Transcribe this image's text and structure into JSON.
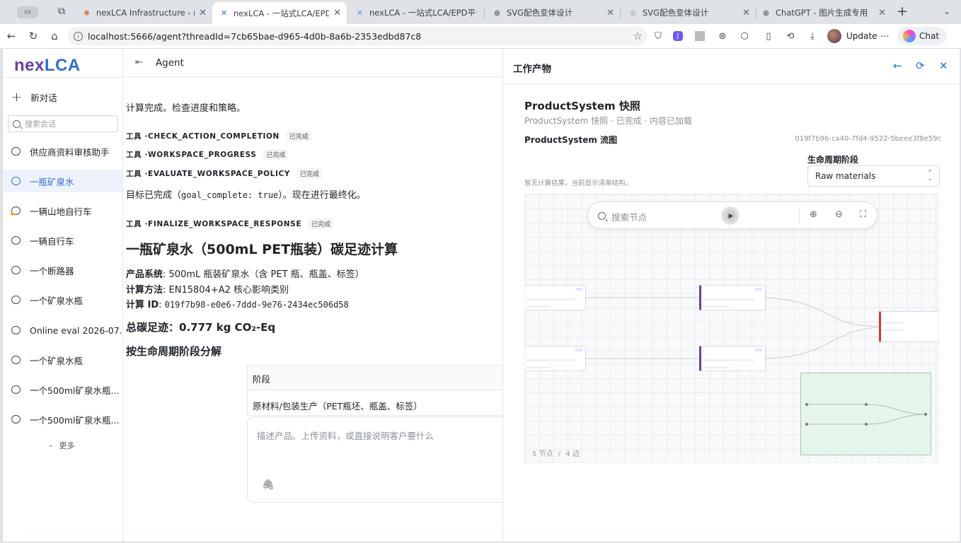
{
  "browser": {
    "tabs": [
      {
        "title": "nexLCA Infrastructure - nexLC",
        "icon": "claude-icon",
        "active": false
      },
      {
        "title": "nexLCA - 一站式LCA/EPD平台",
        "icon": "x-icon",
        "active": true
      },
      {
        "title": "nexLCA - 一站式LCA/EPD平台",
        "icon": "x-icon",
        "active": false
      },
      {
        "title": "SVG配色变体设计",
        "icon": "openai-icon",
        "active": false
      },
      {
        "title": "SVG配色变体设计",
        "icon": "openai-icon",
        "active": false
      },
      {
        "title": "ChatGPT - 图片生成专用",
        "icon": "openai-icon",
        "active": false
      }
    ],
    "url": "localhost:5666/agent?threadId=7cb65bae-d965-4d0b-8a6b-2353edbd87c8",
    "update_label": "Update",
    "chat_label": "Chat"
  },
  "sidebar": {
    "brand_n": "n",
    "brand_rest": "ex",
    "brand_lca": "LCA",
    "new_chat": "新对话",
    "search_placeholder": "搜索会话",
    "conversations": [
      {
        "label": "供应商资料审核助手"
      },
      {
        "label": "一瓶矿泉水"
      },
      {
        "label": "一辆山地自行车"
      },
      {
        "label": "一辆自行车"
      },
      {
        "label": "一个断路器"
      },
      {
        "label": "一个矿泉水瓶"
      },
      {
        "label": "Online eval 2026-07..."
      },
      {
        "label": "一个矿泉水瓶"
      },
      {
        "label": "一个500ml矿泉水瓶..."
      },
      {
        "label": "一个500ml矿泉水瓶..."
      }
    ],
    "more": "更多"
  },
  "main": {
    "title": "Agent",
    "msg_calc_done": "计算完成。检查进度和策略。",
    "tool_prefix": "工具 · ",
    "tools": [
      {
        "name": "CHECK_ACTION_COMPLETION",
        "status": "已完成"
      },
      {
        "name": "WORKSPACE_PROGRESS",
        "status": "已完成"
      },
      {
        "name": "EVALUATE_WORKSPACE_POLICY",
        "status": "已完成"
      }
    ],
    "goal_pre": "目标已完成（",
    "goal_code": "goal_complete: true",
    "goal_post": "）。现在进行最终化。",
    "finalize_tool": {
      "name": "FINALIZE_WORKSPACE_RESPONSE",
      "status": "已完成"
    },
    "report_title": "一瓶矿泉水（500mL PET瓶装）碳足迹计算",
    "product_label": "产品系统",
    "product_value": ": 500mL 瓶装矿泉水（含 PET 瓶、瓶盖、标签）",
    "method_label": "计算方法",
    "method_value": ": EN15804+A2 核心影响类别",
    "calc_id_label": "计算 ID",
    "calc_id_value": "019f7b98-e0e6-7ddd-9e76-2434ec506d58",
    "total_label": "总碳足迹：",
    "total_value": "0.777 kg CO₂-Eq",
    "breakdown_title": "按生命周期阶段分解",
    "table_header": "阶段",
    "table_row1": "原材料/包装生产（PET瓶坯、瓶盖、标签）",
    "composer_placeholder": "描述产品、上传资料，或直接说明客户要什么"
  },
  "panel": {
    "title": "工作产物",
    "ps_title": "ProductSystem 快照",
    "ps_subtitle": "ProductSystem 快照 · 已完成 · 内容已加载",
    "flow_title": "ProductSystem 流图",
    "flow_id": "019f7b96-ca40-7fd4-9522-5beee3f8e59c",
    "lifecycle_label": "生命周期阶段",
    "lifecycle_value": "Raw materials",
    "no_result": "暂无计算结果，当前显示清单结构。",
    "search_nodes_placeholder": "搜索节点",
    "nodes_count": "5 节点",
    "edges_count": "4 边",
    "count_sep": "/"
  },
  "colors": {
    "accent": "#2f6fd1",
    "brand_purple": "#6a3fa0",
    "minimap_bg": "#e6f5ec"
  }
}
